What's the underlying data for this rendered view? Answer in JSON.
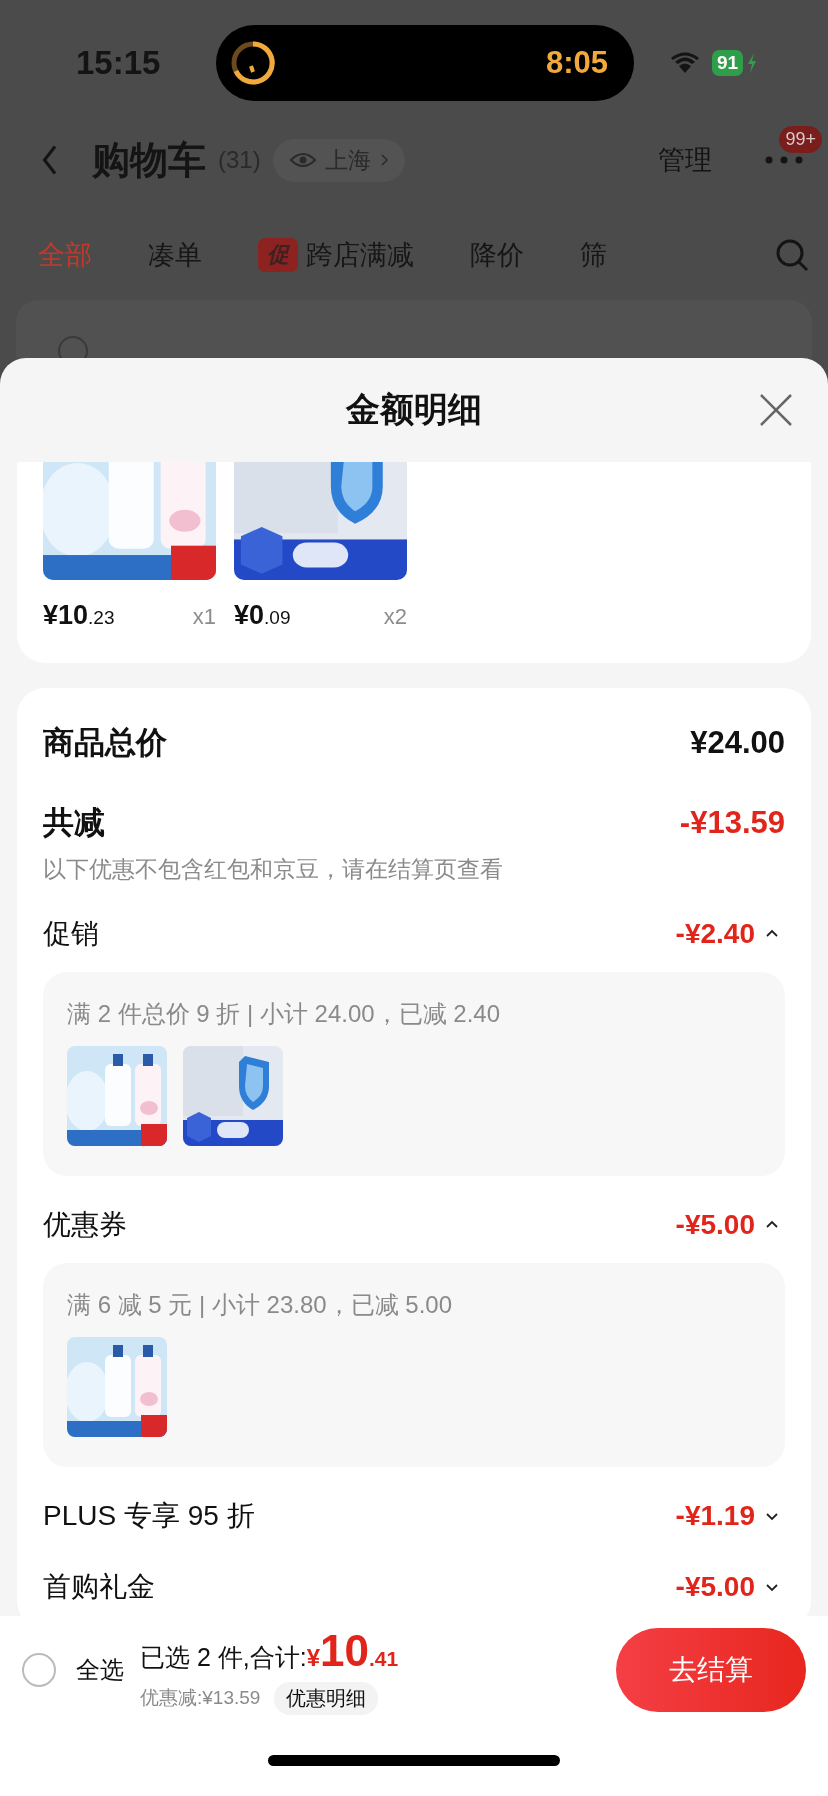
{
  "status_bar": {
    "time": "15:15",
    "timer": "8:05",
    "battery": "91"
  },
  "nav": {
    "title": "购物车",
    "count": "(31)",
    "location": "上海",
    "manage": "管理",
    "badge": "99+"
  },
  "tabs": [
    {
      "label": "全部",
      "selected": true
    },
    {
      "label": "凑单",
      "selected": false
    },
    {
      "label": "跨店满减",
      "tag": "促",
      "selected": false
    },
    {
      "label": "降价",
      "selected": false
    },
    {
      "label": "筛",
      "selected": false
    }
  ],
  "store": {
    "checked": false
  },
  "sheet": {
    "title": "金额明细",
    "products": [
      {
        "kind": "picture",
        "price": "¥10",
        "price_fraction": ".23",
        "quantity": "x1"
      },
      {
        "kind": "picture",
        "price": "¥0",
        "price_fraction": ".09",
        "quantity": "x2"
      }
    ],
    "total": {
      "label": "商品总价",
      "amount": "¥24.00"
    },
    "reduction": {
      "label": "共减",
      "amount": "-¥13.59",
      "note": "以下优惠不包含红包和京豆，请在结算页查看"
    },
    "discounts": [
      {
        "label": "促销",
        "amount": "-¥2.40",
        "expanded": true,
        "detail": "满 2 件总价 9 折 | 小计 24.00，已减 2.40"
      },
      {
        "label": "优惠券",
        "amount": "-¥5.00",
        "expanded": true,
        "detail": "满 6 减 5 元 | 小计 23.80，已减 5.00"
      },
      {
        "label": "PLUS 专享 95 折",
        "amount": "-¥1.19",
        "expanded": false
      },
      {
        "label": "首购礼金",
        "amount": "-¥5.00",
        "expanded": false
      }
    ]
  },
  "checkout": {
    "select_all": {
      "label": "全选",
      "checked": false
    },
    "summary": "已选 2 件,合计:",
    "total": {
      "currency": "¥",
      "integer": "10",
      "fraction": ".41"
    },
    "saved": "优惠减:¥13.59",
    "details_button": "优惠明细",
    "button": "去结算"
  }
}
